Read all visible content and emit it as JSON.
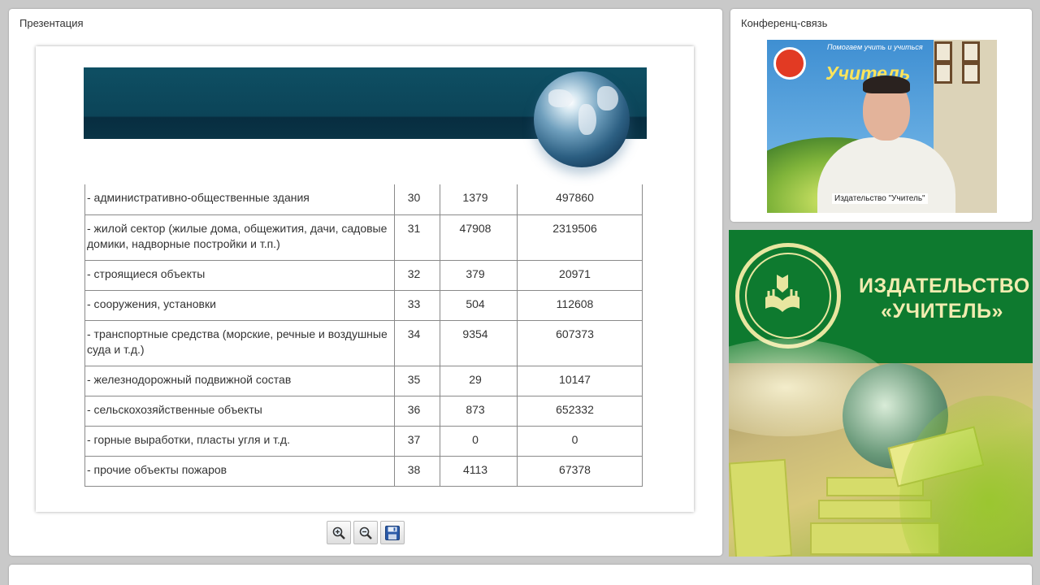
{
  "presentation": {
    "title": "Презентация",
    "table": {
      "rows": [
        {
          "name": "- административно-общественные здания",
          "code": "30",
          "count": "1379",
          "amount": "497860"
        },
        {
          "name": "- жилой сектор (жилые дома, общежития, дачи, садовые домики, надворные постройки и т.п.)",
          "code": "31",
          "count": "47908",
          "amount": "2319506"
        },
        {
          "name": "- строящиеся объекты",
          "code": "32",
          "count": "379",
          "amount": "20971"
        },
        {
          "name": "- сооружения, установки",
          "code": "33",
          "count": "504",
          "amount": "112608"
        },
        {
          "name": "- транспортные средства (морские, речные и воздушные суда и т.д.)",
          "code": "34",
          "count": "9354",
          "amount": "607373"
        },
        {
          "name": "- железнодорожный подвижной состав",
          "code": "35",
          "count": "29",
          "amount": "10147"
        },
        {
          "name": "- сельскохозяйственные объекты",
          "code": "36",
          "count": "873",
          "amount": "652332"
        },
        {
          "name": "- горные выработки, пласты угля и т.д.",
          "code": "37",
          "count": "0",
          "amount": "0"
        },
        {
          "name": "- прочие объекты пожаров",
          "code": "38",
          "count": "4113",
          "amount": "67378"
        }
      ]
    },
    "toolbar": {
      "zoom_in_icon": "zoom-in-icon",
      "zoom_out_icon": "zoom-out-icon",
      "save_icon": "floppy-disk-icon"
    }
  },
  "conference": {
    "title": "Конференц-связь",
    "participant_label": "Издательство \"Учитель\"",
    "banner": {
      "top_text": "Помогаем учить и учиться",
      "brand_text": "Учитель"
    }
  },
  "brand": {
    "line1": "ИЗДАТЕЛЬСТВО",
    "line2": "«УЧИТЕЛЬ»",
    "colors": {
      "green": "#0e7a2f",
      "cream": "#f1ecb0"
    }
  }
}
